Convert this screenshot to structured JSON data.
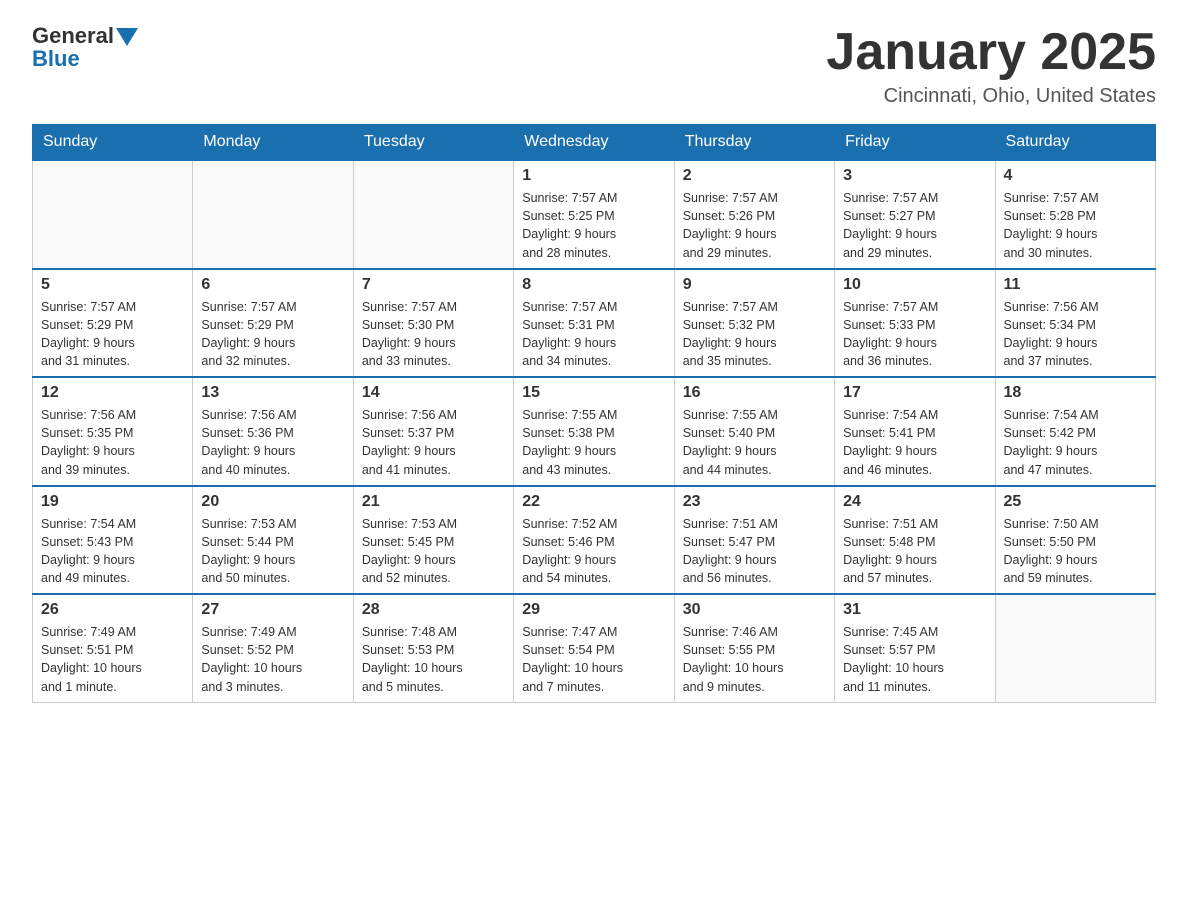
{
  "header": {
    "logo_line1": "General",
    "logo_line2": "Blue",
    "month_title": "January 2025",
    "location": "Cincinnati, Ohio, United States"
  },
  "weekdays": [
    "Sunday",
    "Monday",
    "Tuesday",
    "Wednesday",
    "Thursday",
    "Friday",
    "Saturday"
  ],
  "weeks": [
    [
      {
        "day": "",
        "info": ""
      },
      {
        "day": "",
        "info": ""
      },
      {
        "day": "",
        "info": ""
      },
      {
        "day": "1",
        "info": "Sunrise: 7:57 AM\nSunset: 5:25 PM\nDaylight: 9 hours\nand 28 minutes."
      },
      {
        "day": "2",
        "info": "Sunrise: 7:57 AM\nSunset: 5:26 PM\nDaylight: 9 hours\nand 29 minutes."
      },
      {
        "day": "3",
        "info": "Sunrise: 7:57 AM\nSunset: 5:27 PM\nDaylight: 9 hours\nand 29 minutes."
      },
      {
        "day": "4",
        "info": "Sunrise: 7:57 AM\nSunset: 5:28 PM\nDaylight: 9 hours\nand 30 minutes."
      }
    ],
    [
      {
        "day": "5",
        "info": "Sunrise: 7:57 AM\nSunset: 5:29 PM\nDaylight: 9 hours\nand 31 minutes."
      },
      {
        "day": "6",
        "info": "Sunrise: 7:57 AM\nSunset: 5:29 PM\nDaylight: 9 hours\nand 32 minutes."
      },
      {
        "day": "7",
        "info": "Sunrise: 7:57 AM\nSunset: 5:30 PM\nDaylight: 9 hours\nand 33 minutes."
      },
      {
        "day": "8",
        "info": "Sunrise: 7:57 AM\nSunset: 5:31 PM\nDaylight: 9 hours\nand 34 minutes."
      },
      {
        "day": "9",
        "info": "Sunrise: 7:57 AM\nSunset: 5:32 PM\nDaylight: 9 hours\nand 35 minutes."
      },
      {
        "day": "10",
        "info": "Sunrise: 7:57 AM\nSunset: 5:33 PM\nDaylight: 9 hours\nand 36 minutes."
      },
      {
        "day": "11",
        "info": "Sunrise: 7:56 AM\nSunset: 5:34 PM\nDaylight: 9 hours\nand 37 minutes."
      }
    ],
    [
      {
        "day": "12",
        "info": "Sunrise: 7:56 AM\nSunset: 5:35 PM\nDaylight: 9 hours\nand 39 minutes."
      },
      {
        "day": "13",
        "info": "Sunrise: 7:56 AM\nSunset: 5:36 PM\nDaylight: 9 hours\nand 40 minutes."
      },
      {
        "day": "14",
        "info": "Sunrise: 7:56 AM\nSunset: 5:37 PM\nDaylight: 9 hours\nand 41 minutes."
      },
      {
        "day": "15",
        "info": "Sunrise: 7:55 AM\nSunset: 5:38 PM\nDaylight: 9 hours\nand 43 minutes."
      },
      {
        "day": "16",
        "info": "Sunrise: 7:55 AM\nSunset: 5:40 PM\nDaylight: 9 hours\nand 44 minutes."
      },
      {
        "day": "17",
        "info": "Sunrise: 7:54 AM\nSunset: 5:41 PM\nDaylight: 9 hours\nand 46 minutes."
      },
      {
        "day": "18",
        "info": "Sunrise: 7:54 AM\nSunset: 5:42 PM\nDaylight: 9 hours\nand 47 minutes."
      }
    ],
    [
      {
        "day": "19",
        "info": "Sunrise: 7:54 AM\nSunset: 5:43 PM\nDaylight: 9 hours\nand 49 minutes."
      },
      {
        "day": "20",
        "info": "Sunrise: 7:53 AM\nSunset: 5:44 PM\nDaylight: 9 hours\nand 50 minutes."
      },
      {
        "day": "21",
        "info": "Sunrise: 7:53 AM\nSunset: 5:45 PM\nDaylight: 9 hours\nand 52 minutes."
      },
      {
        "day": "22",
        "info": "Sunrise: 7:52 AM\nSunset: 5:46 PM\nDaylight: 9 hours\nand 54 minutes."
      },
      {
        "day": "23",
        "info": "Sunrise: 7:51 AM\nSunset: 5:47 PM\nDaylight: 9 hours\nand 56 minutes."
      },
      {
        "day": "24",
        "info": "Sunrise: 7:51 AM\nSunset: 5:48 PM\nDaylight: 9 hours\nand 57 minutes."
      },
      {
        "day": "25",
        "info": "Sunrise: 7:50 AM\nSunset: 5:50 PM\nDaylight: 9 hours\nand 59 minutes."
      }
    ],
    [
      {
        "day": "26",
        "info": "Sunrise: 7:49 AM\nSunset: 5:51 PM\nDaylight: 10 hours\nand 1 minute."
      },
      {
        "day": "27",
        "info": "Sunrise: 7:49 AM\nSunset: 5:52 PM\nDaylight: 10 hours\nand 3 minutes."
      },
      {
        "day": "28",
        "info": "Sunrise: 7:48 AM\nSunset: 5:53 PM\nDaylight: 10 hours\nand 5 minutes."
      },
      {
        "day": "29",
        "info": "Sunrise: 7:47 AM\nSunset: 5:54 PM\nDaylight: 10 hours\nand 7 minutes."
      },
      {
        "day": "30",
        "info": "Sunrise: 7:46 AM\nSunset: 5:55 PM\nDaylight: 10 hours\nand 9 minutes."
      },
      {
        "day": "31",
        "info": "Sunrise: 7:45 AM\nSunset: 5:57 PM\nDaylight: 10 hours\nand 11 minutes."
      },
      {
        "day": "",
        "info": ""
      }
    ]
  ]
}
